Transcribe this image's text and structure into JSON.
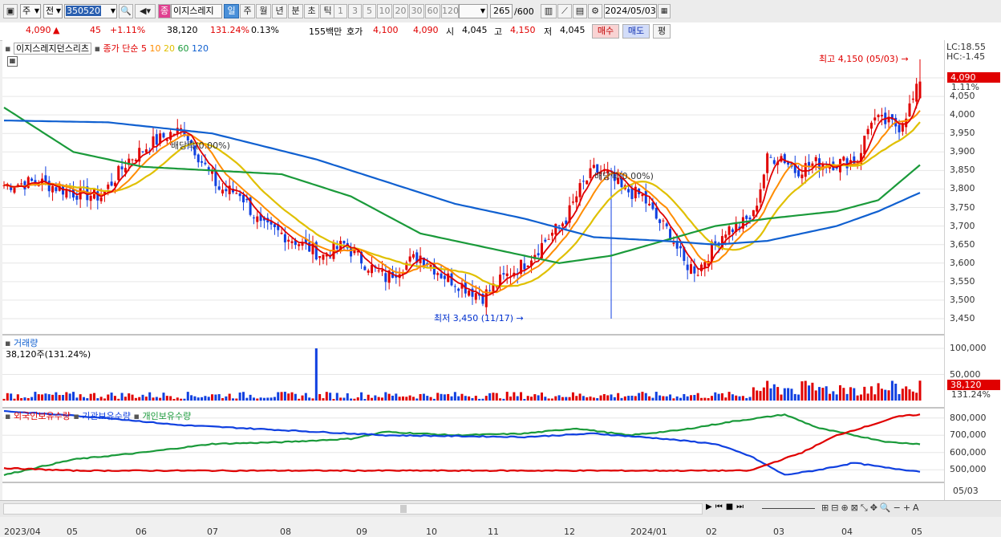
{
  "toolbar": {
    "market_select": "주",
    "prev_label": "전",
    "code": "350520",
    "name_badge": "종",
    "name": "이지스레지",
    "periods": [
      {
        "label": "일",
        "selected": true
      },
      {
        "label": "주",
        "selected": false
      },
      {
        "label": "월",
        "selected": false
      },
      {
        "label": "년",
        "selected": false
      },
      {
        "label": "분",
        "selected": false
      },
      {
        "label": "초",
        "selected": false
      },
      {
        "label": "틱",
        "selected": false
      }
    ],
    "intervals": [
      "1",
      "3",
      "5",
      "10",
      "20",
      "30",
      "60",
      "120"
    ],
    "count": "265",
    "count_max": "/600",
    "date": "2024/05/03"
  },
  "quote": {
    "price": "4,090",
    "change_arrow": "▲",
    "change": "45",
    "change_pct": "+1.11%",
    "volume": "38,120",
    "volume_ratio": "131.24%",
    "turnover": "0.13%",
    "amount": "155백만",
    "bid_label": "호가",
    "bid1": "4,100",
    "bid2": "4,090",
    "open_label": "시",
    "open": "4,045",
    "high_label": "고",
    "high": "4,150",
    "low_label": "저",
    "low": "4,045",
    "buy_label": "매수",
    "sell_label": "매도",
    "eval_label": "평"
  },
  "legend": {
    "name": "이지스레지던스리츠",
    "ma_label": "종가 단순",
    "ma_periods": [
      "5",
      "10",
      "20",
      "60",
      "120"
    ],
    "ma_colors": [
      "#e00000",
      "#ff8c00",
      "#e0c000",
      "#1a9a3a",
      "#1060d0"
    ]
  },
  "annotations": {
    "lc": "LC:18.55",
    "hc": "HC:-1.45",
    "high_note": "최고 4,150 (05/03)",
    "low_note": "최저 3,450 (11/17)",
    "div1": "배당락(0.00%)",
    "div2": "배당락(0.00%)",
    "price_tag": "4,090",
    "price_tag_pct": "1.11%",
    "vol_tag": "38,120",
    "vol_tag_pct": "131.24%"
  },
  "volume_panel": {
    "title": "거래량",
    "summary": "38,120주(131.24%)"
  },
  "holdings_panel": {
    "series": [
      "외국인보유수량",
      "기관보유수량",
      "개인보유수량"
    ]
  },
  "x_labels": [
    "2023/04",
    "05",
    "06",
    "07",
    "08",
    "09",
    "10",
    "11",
    "12",
    "2024/01",
    "02",
    "03",
    "04",
    "05"
  ],
  "x_end_label": "05/03",
  "colors": {
    "up": "#e00000",
    "down": "#1040e0",
    "accent": "#4a90d9"
  },
  "chart_data": {
    "type": "candlestick",
    "price_axis": {
      "ticks": [
        3450,
        3500,
        3550,
        3600,
        3650,
        3700,
        3750,
        3800,
        3850,
        3900,
        3950,
        4000,
        4050,
        4100
      ],
      "labels": [
        "3,450",
        "3,500",
        "3,550",
        "3,600",
        "3,650",
        "3,700",
        "3,750",
        "3,800",
        "3,850",
        "3,900",
        "3,950",
        "4,000",
        "4,050",
        "4,100"
      ]
    },
    "volume_axis": {
      "ticks": [
        50000,
        100000
      ],
      "labels": [
        "50,000",
        "100,000"
      ]
    },
    "holdings_axis": {
      "ticks": [
        500000,
        600000,
        700000,
        800000
      ],
      "labels": [
        "500,000",
        "600,000",
        "700,000",
        "800,000"
      ]
    },
    "close_keypoints": [
      {
        "x": 0,
        "y": 3810
      },
      {
        "x": 10,
        "y": 3820
      },
      {
        "x": 20,
        "y": 3790
      },
      {
        "x": 28,
        "y": 3780
      },
      {
        "x": 36,
        "y": 3880
      },
      {
        "x": 42,
        "y": 3920
      },
      {
        "x": 48,
        "y": 3950
      },
      {
        "x": 52,
        "y": 3960
      },
      {
        "x": 56,
        "y": 3890
      },
      {
        "x": 62,
        "y": 3800
      },
      {
        "x": 68,
        "y": 3790
      },
      {
        "x": 74,
        "y": 3700
      },
      {
        "x": 80,
        "y": 3680
      },
      {
        "x": 86,
        "y": 3650
      },
      {
        "x": 92,
        "y": 3620
      },
      {
        "x": 98,
        "y": 3650
      },
      {
        "x": 104,
        "y": 3600
      },
      {
        "x": 110,
        "y": 3560
      },
      {
        "x": 116,
        "y": 3600
      },
      {
        "x": 120,
        "y": 3620
      },
      {
        "x": 126,
        "y": 3570
      },
      {
        "x": 132,
        "y": 3540
      },
      {
        "x": 138,
        "y": 3510
      },
      {
        "x": 144,
        "y": 3560
      },
      {
        "x": 150,
        "y": 3600
      },
      {
        "x": 156,
        "y": 3660
      },
      {
        "x": 162,
        "y": 3720
      },
      {
        "x": 166,
        "y": 3800
      },
      {
        "x": 170,
        "y": 3850
      },
      {
        "x": 174,
        "y": 3840
      },
      {
        "x": 178,
        "y": 3800
      },
      {
        "x": 184,
        "y": 3780
      },
      {
        "x": 188,
        "y": 3720
      },
      {
        "x": 192,
        "y": 3680
      },
      {
        "x": 196,
        "y": 3600
      },
      {
        "x": 200,
        "y": 3580
      },
      {
        "x": 204,
        "y": 3640
      },
      {
        "x": 208,
        "y": 3690
      },
      {
        "x": 212,
        "y": 3700
      },
      {
        "x": 216,
        "y": 3730
      },
      {
        "x": 220,
        "y": 3880
      },
      {
        "x": 224,
        "y": 3890
      },
      {
        "x": 228,
        "y": 3850
      },
      {
        "x": 234,
        "y": 3870
      },
      {
        "x": 240,
        "y": 3870
      },
      {
        "x": 246,
        "y": 3880
      },
      {
        "x": 250,
        "y": 3990
      },
      {
        "x": 254,
        "y": 3980
      },
      {
        "x": 258,
        "y": 3970
      },
      {
        "x": 262,
        "y": 4040
      },
      {
        "x": 264,
        "y": 4090
      }
    ],
    "ma60_keypoints": [
      [
        0,
        4020
      ],
      [
        20,
        3900
      ],
      [
        40,
        3860
      ],
      [
        60,
        3850
      ],
      [
        80,
        3840
      ],
      [
        100,
        3780
      ],
      [
        120,
        3680
      ],
      [
        140,
        3640
      ],
      [
        160,
        3600
      ],
      [
        175,
        3620
      ],
      [
        190,
        3660
      ],
      [
        205,
        3700
      ],
      [
        220,
        3720
      ],
      [
        240,
        3740
      ],
      [
        252,
        3770
      ],
      [
        264,
        3865
      ]
    ],
    "ma120_keypoints": [
      [
        0,
        3985
      ],
      [
        30,
        3980
      ],
      [
        60,
        3950
      ],
      [
        90,
        3880
      ],
      [
        110,
        3820
      ],
      [
        130,
        3760
      ],
      [
        150,
        3720
      ],
      [
        170,
        3670
      ],
      [
        190,
        3660
      ],
      [
        205,
        3650
      ],
      [
        220,
        3660
      ],
      [
        240,
        3700
      ],
      [
        252,
        3740
      ],
      [
        264,
        3790
      ]
    ],
    "foreign_keypoints": [
      [
        0,
        510
      ],
      [
        20,
        495
      ],
      [
        60,
        495
      ],
      [
        120,
        495
      ],
      [
        200,
        495
      ],
      [
        215,
        495
      ],
      [
        230,
        600
      ],
      [
        240,
        700
      ],
      [
        250,
        760
      ],
      [
        258,
        810
      ],
      [
        264,
        820
      ]
    ],
    "institution_keypoints": [
      [
        0,
        840
      ],
      [
        30,
        800
      ],
      [
        50,
        760
      ],
      [
        80,
        730
      ],
      [
        110,
        700
      ],
      [
        150,
        690
      ],
      [
        170,
        710
      ],
      [
        190,
        680
      ],
      [
        205,
        650
      ],
      [
        215,
        580
      ],
      [
        225,
        470
      ],
      [
        235,
        500
      ],
      [
        245,
        540
      ],
      [
        255,
        510
      ],
      [
        264,
        490
      ]
    ],
    "individual_keypoints": [
      [
        0,
        470
      ],
      [
        20,
        560
      ],
      [
        40,
        600
      ],
      [
        60,
        650
      ],
      [
        80,
        660
      ],
      [
        100,
        680
      ],
      [
        110,
        720
      ],
      [
        130,
        700
      ],
      [
        150,
        710
      ],
      [
        165,
        740
      ],
      [
        180,
        700
      ],
      [
        195,
        730
      ],
      [
        210,
        780
      ],
      [
        225,
        820
      ],
      [
        235,
        740
      ],
      [
        245,
        700
      ],
      [
        255,
        660
      ],
      [
        264,
        650
      ]
    ]
  }
}
